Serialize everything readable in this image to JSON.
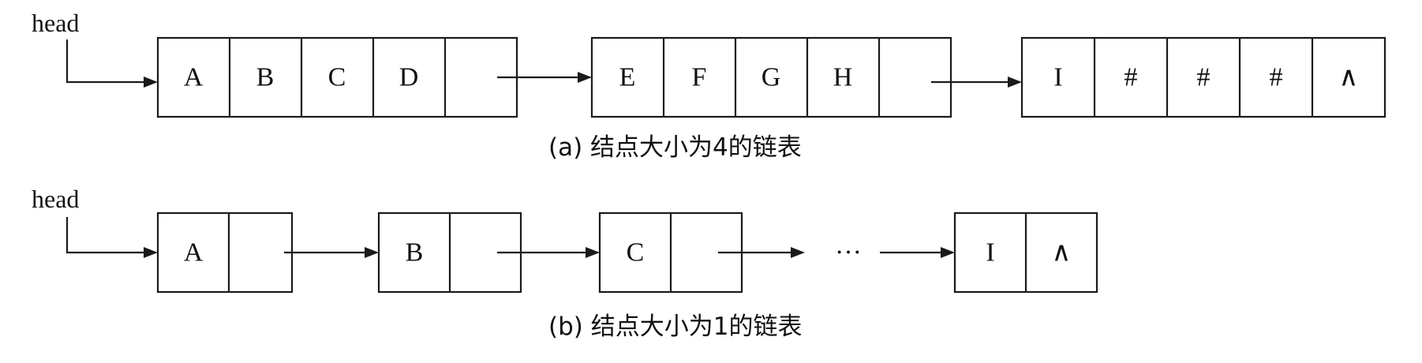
{
  "list_a": {
    "head_label": "head",
    "nodes": [
      [
        "A",
        "B",
        "C",
        "D",
        ""
      ],
      [
        "E",
        "F",
        "G",
        "H",
        ""
      ],
      [
        "I",
        "#",
        "#",
        "#",
        "∧"
      ]
    ],
    "caption": "(a) 结点大小为4的链表"
  },
  "list_b": {
    "head_label": "head",
    "nodes": [
      [
        "A",
        ""
      ],
      [
        "B",
        ""
      ],
      [
        "C",
        ""
      ],
      [
        "I",
        "∧"
      ]
    ],
    "ellipsis": "···",
    "caption": "(b) 结点大小为1的链表"
  }
}
